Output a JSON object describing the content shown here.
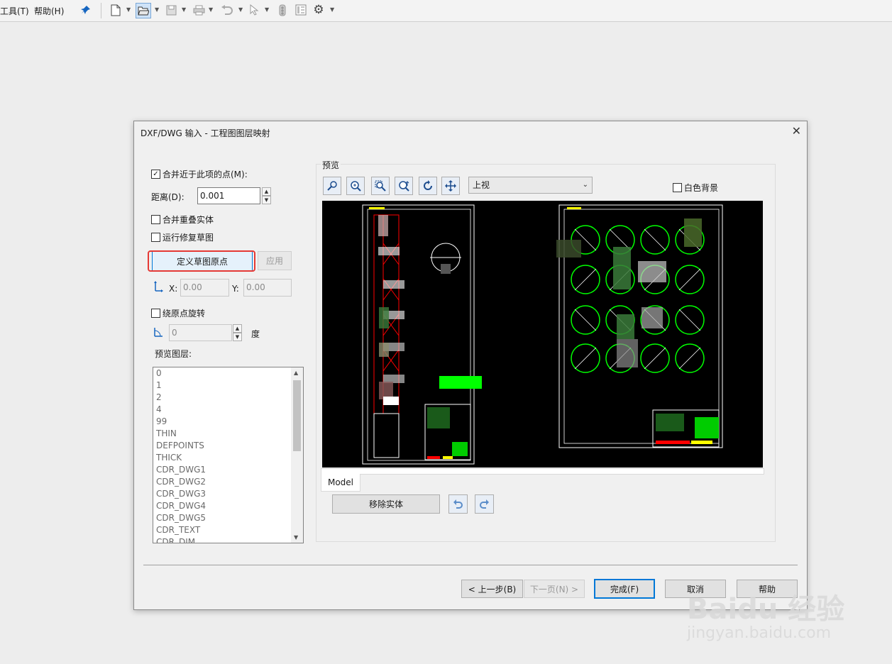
{
  "menubar": {
    "tools": "工具(T)",
    "help": "帮助(H)"
  },
  "toolbar": {
    "icons": [
      "pin-icon",
      "new-file-icon",
      "open-file-icon",
      "save-icon",
      "print-icon",
      "undo-icon",
      "select-icon",
      "traffic-light-icon",
      "options-list-icon",
      "gear-icon"
    ]
  },
  "dialog": {
    "title": "DXF/DWG 输入 - 工程图图层映射",
    "merge_points": {
      "label": "合并近于此项的点(M):",
      "checked": true
    },
    "distance": {
      "label": "距离(D):",
      "value": "0.001"
    },
    "merge_overlap": {
      "label": "合并重叠实体",
      "checked": false
    },
    "run_repair": {
      "label": "运行修复草图",
      "checked": false
    },
    "define_origin_button": "定义草图原点",
    "apply_button": "应用",
    "x": {
      "label": "X:",
      "value": "0.00"
    },
    "y": {
      "label": "Y:",
      "value": "0.00"
    },
    "rotate": {
      "label": "绕原点旋转",
      "checked": false
    },
    "angle": {
      "value": "0",
      "unit": "度"
    },
    "preview_layers_label": "预览图层:",
    "layers": [
      "0",
      "1",
      "2",
      "4",
      "99",
      "THIN",
      "DEFPOINTS",
      "THICK",
      "CDR_DWG1",
      "CDR_DWG2",
      "CDR_DWG3",
      "CDR_DWG4",
      "CDR_DWG5",
      "CDR_TEXT",
      "CDR_DIM"
    ],
    "preview": {
      "group_label": "预览",
      "view_select": "上视",
      "white_bg": {
        "label": "白色背景",
        "checked": false
      },
      "tab": "Model",
      "remove_button": "移除实体"
    },
    "footer": {
      "back": "< 上一步(B)",
      "next": "下一页(N) >",
      "finish": "完成(F)",
      "cancel": "取消",
      "help": "帮助"
    }
  },
  "watermark": {
    "brand": "Baidu 经验",
    "url": "jingyan.baidu.com"
  },
  "colors": {
    "highlight": "#e53935",
    "accent": "#0078d7",
    "cad_green": "#00ff00",
    "cad_red": "#ff0000"
  }
}
